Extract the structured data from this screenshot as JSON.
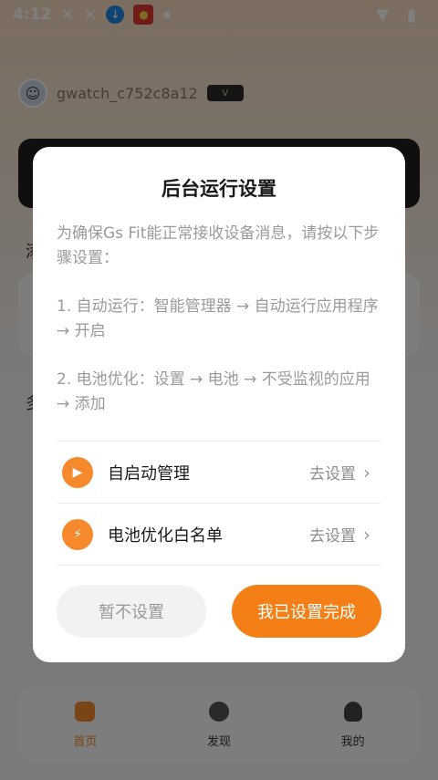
{
  "status_bar": {
    "time": "4:12",
    "icons": [
      "x-icon",
      "x-icon",
      "download-icon",
      "app-icon",
      "dot-icon",
      "wifi-icon",
      "battery-icon"
    ]
  },
  "profile": {
    "username": "gwatch_c752c8a12",
    "badge": "V"
  },
  "background": {
    "section_a_partial": "添",
    "section_b_partial": "多"
  },
  "tabs": [
    {
      "label": "首页",
      "icon": "home-icon",
      "active": true
    },
    {
      "label": "发现",
      "icon": "planet-icon",
      "active": false
    },
    {
      "label": "我的",
      "icon": "person-icon",
      "active": false
    }
  ],
  "dialog": {
    "title": "后台运行设置",
    "intro": "为确保Gs Fit能正常接收设备消息，请按以下步骤设置：",
    "step1": "1. 自动运行：智能管理器 → 自动运行应用程序 → 开启",
    "step2": "2. 电池优化：设置 → 电池 → 不受监视的应用 → 添加",
    "rows": [
      {
        "label": "自启动管理",
        "action": "去设置",
        "icon": "play-icon"
      },
      {
        "label": "电池优化白名单",
        "action": "去设置",
        "icon": "battery-icon"
      }
    ],
    "cancel_label": "暂不设置",
    "confirm_label": "我已设置完成"
  },
  "colors": {
    "accent": "#f57f17",
    "overlay": "#00000080"
  }
}
